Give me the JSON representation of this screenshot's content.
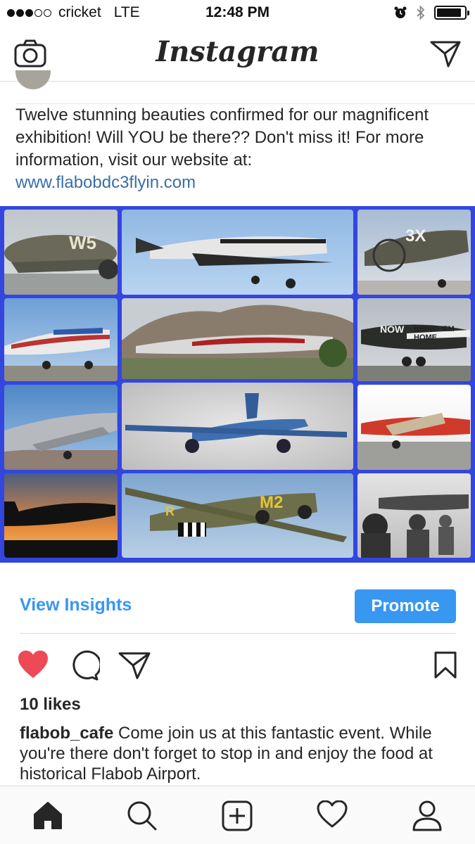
{
  "status_bar": {
    "carrier": "cricket",
    "network": "LTE",
    "time": "12:48 PM",
    "signal_bars_filled": 3,
    "signal_bars_total": 5,
    "battery_level": 0.9
  },
  "nav": {
    "logo": "Instagram",
    "left_icon": "camera-icon",
    "right_icon": "direct-message-icon"
  },
  "post": {
    "caption": "Twelve stunning beauties confirmed for our magnificent exhibition! Will YOU be there?? Don't miss it! For more information, visit our website at:",
    "link": "www.flabobdc3flyin.com",
    "image_labels": {
      "tile_1_tail": "W5",
      "tile_3_tail": "3X",
      "tile_6_nose": "NOW",
      "tile_6_text": "BRING 'EM HOME",
      "tile_11_code": "M2",
      "tile_11_tail": "R"
    }
  },
  "actions": {
    "view_insights": "View Insights",
    "promote": "Promote",
    "like_icon": "heart-filled-icon",
    "comment_icon": "comment-icon",
    "share_icon": "share-icon",
    "save_icon": "bookmark-icon"
  },
  "likes": "10 likes",
  "comment": {
    "username": "flabob_cafe",
    "text": "Come join us at this fantastic event. While you're there don't forget to stop in and enjoy the food at historical Flabob Airport."
  },
  "tab_bar": {
    "items": [
      "home-icon",
      "search-icon",
      "add-post-icon",
      "activity-icon",
      "profile-icon"
    ],
    "active": "home-icon"
  },
  "colors": {
    "accent": "#3897f0",
    "like": "#ed4956",
    "image_frame": "#3346e0",
    "link": "#3a6ea5"
  }
}
